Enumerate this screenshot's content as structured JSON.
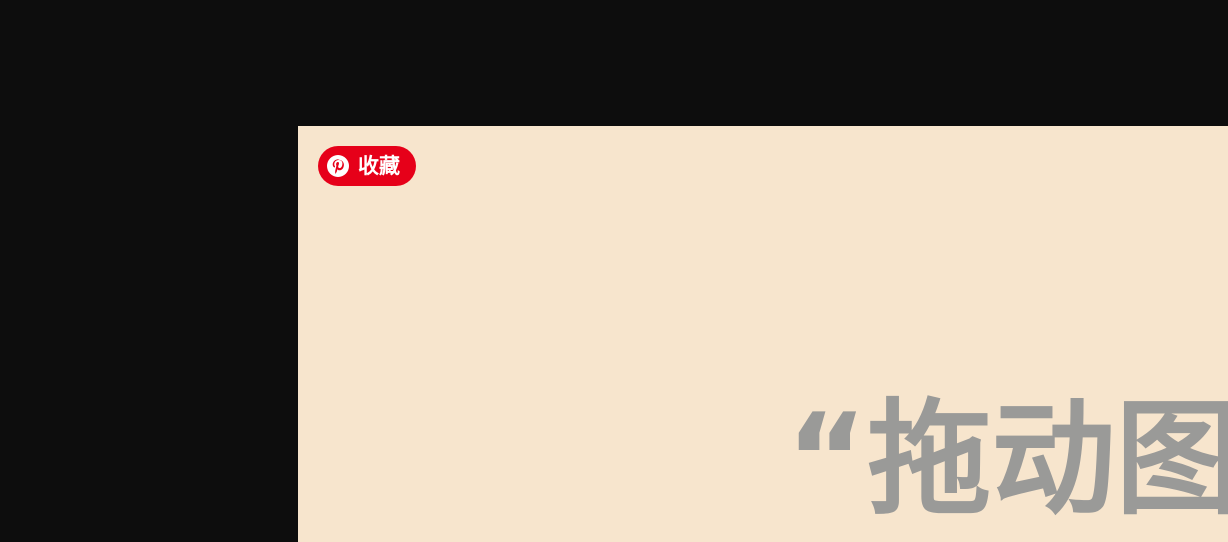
{
  "save_button": {
    "label": "收藏",
    "icon": "pinterest-logo-icon",
    "color": "#e60019"
  },
  "image": {
    "background_color": "#f7e5cd",
    "hero_text": "“拖动图片"
  },
  "page": {
    "background_color": "#0d0d0d"
  }
}
